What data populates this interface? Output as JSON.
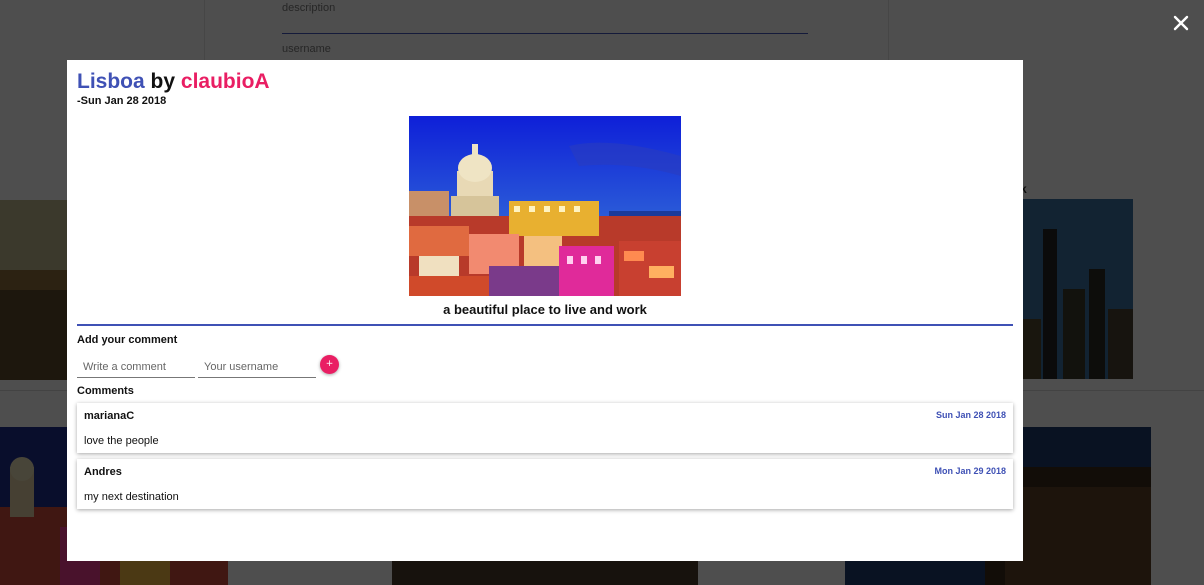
{
  "background_form": {
    "description_placeholder": "description",
    "username_placeholder": "username"
  },
  "background_card_title_fragment": "k",
  "modal": {
    "city": "Lisboa",
    "by_word": "by",
    "author": "claubioA",
    "date": "-Sun Jan 28 2018",
    "caption": "a beautiful place to live and work",
    "add_comment": {
      "heading": "Add your comment",
      "comment_placeholder": "Write a comment",
      "username_placeholder": "Your username",
      "submit_label": "+"
    },
    "comments_heading": "Comments",
    "comments": [
      {
        "author": "marianaC",
        "date": "Sun Jan 28 2018",
        "text": "love the people"
      },
      {
        "author": "Andres",
        "date": "Mon Jan 29 2018",
        "text": "my next destination"
      }
    ]
  },
  "icons": {
    "close": "close-icon",
    "photo": "photo-image"
  },
  "colors": {
    "primary": "#3f51b5",
    "accent": "#e91e63",
    "overlay": "rgba(0,0,0,0.68)"
  }
}
